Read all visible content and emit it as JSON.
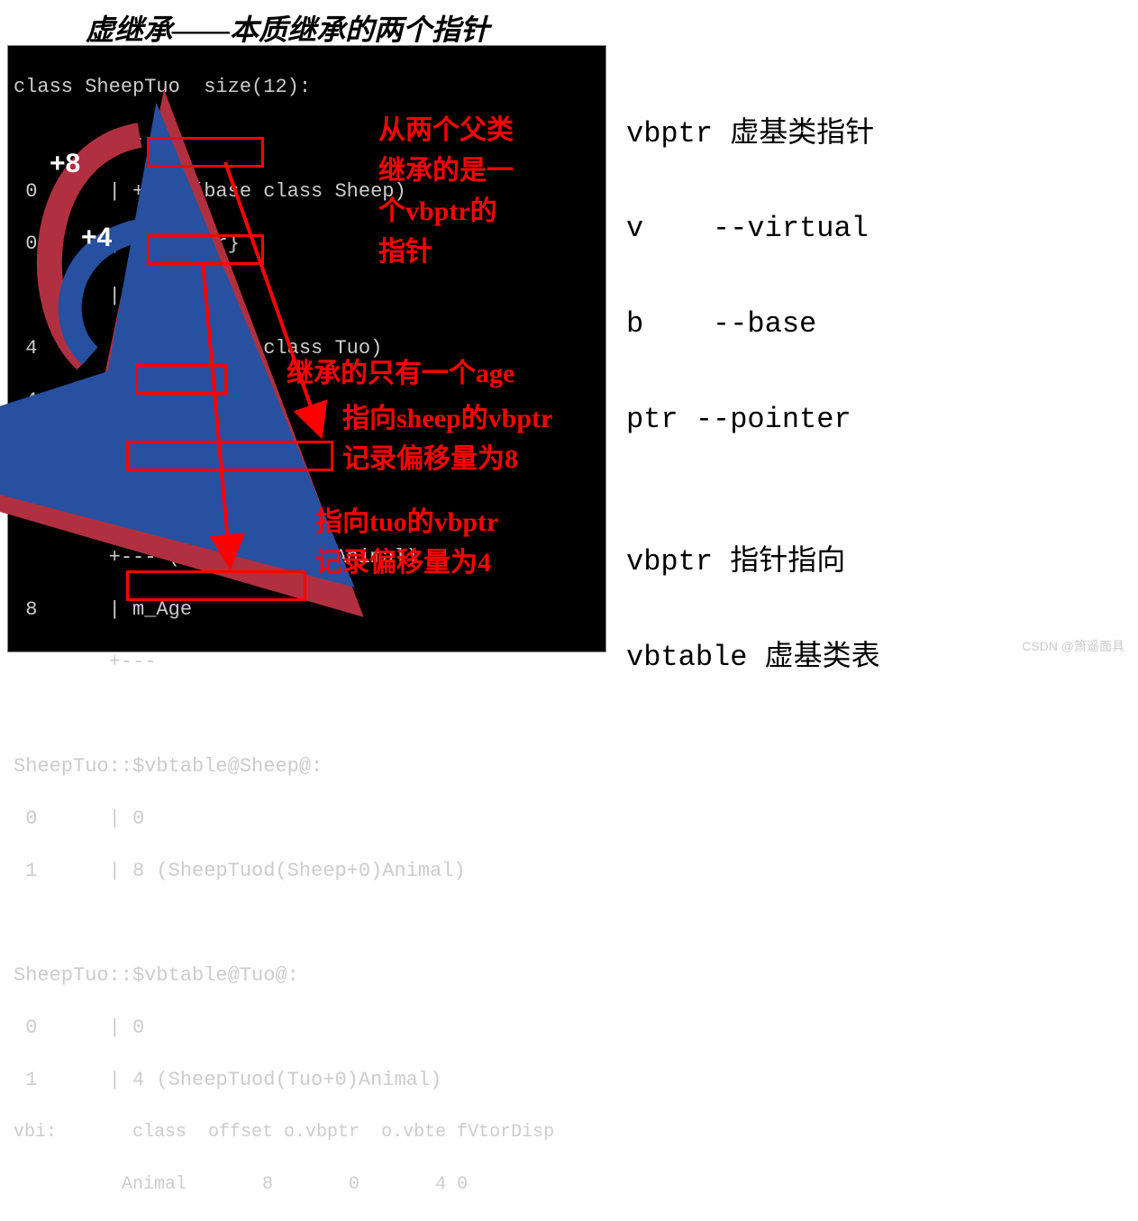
{
  "title": "虚继承——本质继承的两个指针",
  "right_note": {
    "l1": "vbptr 虚基类指针",
    "l2": "v    --virtual",
    "l3": "b    --base",
    "l4": "ptr --pointer",
    "l5": "",
    "l6": "vbptr 指针指向",
    "l7": "vbtable 虚基类表"
  },
  "terminal": {
    "l01": "class SheepTuo  size(12):",
    "l02": "        +---",
    "l03": " 0      | +--- (base class Sheep)",
    "l04": " 0      | | {vbptr}",
    "l05": "        | +---",
    "l06": " 4      | +--- (base class Tuo)",
    "l07": " 4      | | {vbptr}",
    "l08": "        | +---",
    "l09": "        +---",
    "l10": "        +--- (virtual base Animal)",
    "l11": " 8      | m_Age",
    "l12": "        +---",
    "l13": "",
    "l14": "SheepTuo::$vbtable@Sheep@:",
    "l15": " 0      | 0",
    "l16": " 1      | 8 (SheepTuod(Sheep+0)Animal)",
    "l17": "",
    "l18": "SheepTuo::$vbtable@Tuo@:",
    "l19": " 0      | 0",
    "l20": " 1      | 4 (SheepTuod(Tuo+0)Animal)",
    "l21": "vbi:       class  offset o.vbptr  o.vbte fVtorDisp",
    "l22": "          Animal       8       0       4 0"
  },
  "annotations": {
    "a1": "从两个父类",
    "a2": "继承的是一",
    "a3": "个vbptr的",
    "a4": "指针",
    "age": "继承的只有一个age",
    "sheep1": "指向sheep的vbptr",
    "sheep2": "记录偏移量为8",
    "tuo1": "指向tuo的vbptr",
    "tuo2": "记录偏移量为4"
  },
  "offsets": {
    "plus8": "+8",
    "plus4": "+4"
  },
  "watermark": "CSDN @箫遥面具"
}
